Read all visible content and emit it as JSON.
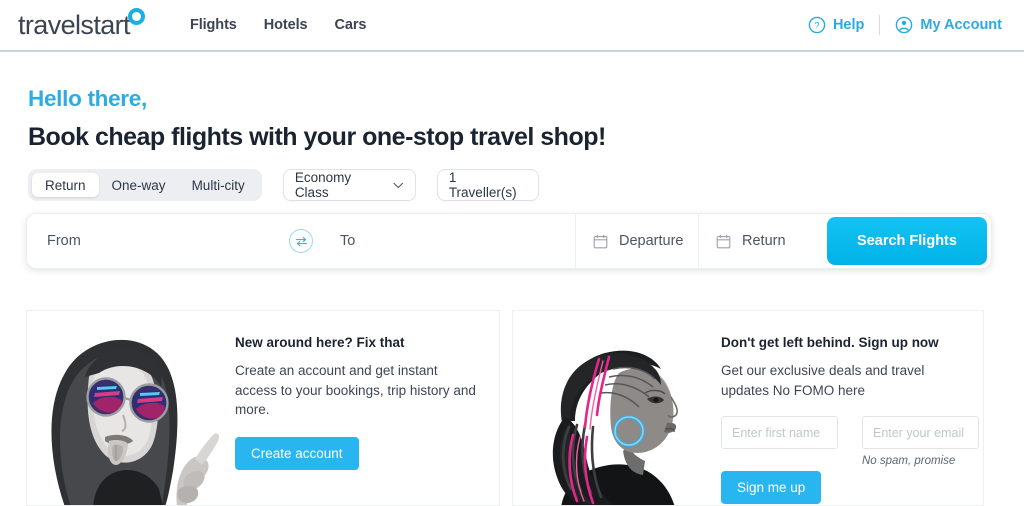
{
  "brand": {
    "name": "travelstart",
    "accent": "#1eaee6",
    "cta_color": "#00b2e6",
    "heading_color": "#1a2330",
    "greeting_color": "#2dace4"
  },
  "header": {
    "logo_text": "travelstart",
    "nav": [
      {
        "label": "Flights"
      },
      {
        "label": "Hotels"
      },
      {
        "label": "Cars"
      }
    ],
    "help_label": "Help",
    "account_label": "My Account"
  },
  "hero": {
    "greeting": "Hello there,",
    "headline": "Book cheap flights with your one-stop travel shop!"
  },
  "search": {
    "trip_tabs": [
      {
        "label": "Return",
        "active": true
      },
      {
        "label": "One-way",
        "active": false
      },
      {
        "label": "Multi-city",
        "active": false
      }
    ],
    "cabin_class": "Economy Class",
    "travellers": "1 Traveller(s)",
    "from_placeholder": "From",
    "to_placeholder": "To",
    "departure_placeholder": "Departure",
    "return_placeholder": "Return",
    "search_button": "Search Flights"
  },
  "promos": [
    {
      "title": "New around here? Fix that",
      "text": "Create an account and get instant access to your bookings, trip history and more.",
      "button": "Create account",
      "image_alt": "woman-with-sunglasses-photo"
    },
    {
      "title": "Don't get left behind. Sign up now",
      "text": "Get our exclusive deals and travel updates No FOMO here",
      "first_name_placeholder": "Enter first name",
      "email_placeholder": "Enter your email",
      "note": "No spam, promise",
      "button": "Sign me up",
      "image_alt": "woman-with-braids-portrait"
    }
  ]
}
